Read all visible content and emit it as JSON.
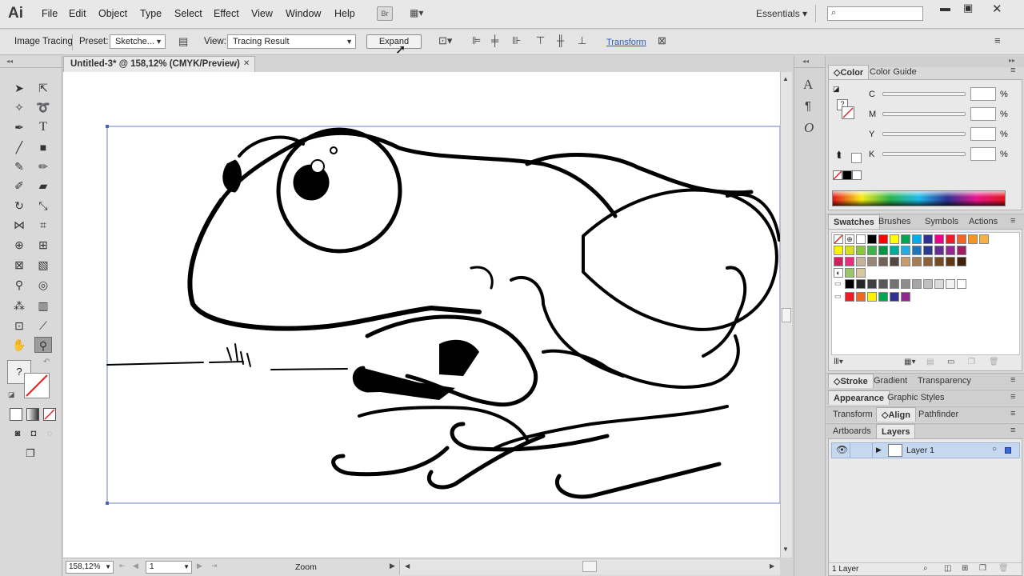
{
  "app": {
    "logo": "Ai"
  },
  "menu": [
    "File",
    "Edit",
    "Object",
    "Type",
    "Select",
    "Effect",
    "View",
    "Window",
    "Help"
  ],
  "menu_buttons": {
    "bridge": "Br"
  },
  "workspace": "Essentials",
  "control_bar": {
    "mode_label": "Image Tracing",
    "preset_label": "Preset:",
    "preset_value": "Sketche...",
    "view_label": "View:",
    "view_value": "Tracing Result",
    "expand_label": "Expand",
    "transform_link": "Transform"
  },
  "document": {
    "tab_title": "Untitled-3* @ 158,12% (CMYK/Preview)"
  },
  "status": {
    "zoom": "158,12%",
    "page": "1",
    "tool_name": "Zoom"
  },
  "color_panel": {
    "tabs": [
      "Color",
      "Color Guide"
    ],
    "channels": [
      "C",
      "M",
      "Y",
      "K"
    ],
    "unit": "%"
  },
  "swatches_panel": {
    "tabs": [
      "Swatches",
      "Brushes",
      "Symbols",
      "Actions"
    ]
  },
  "swatch_rows": [
    [
      "#ffffff",
      "#000000",
      "#ff0000",
      "#ffff00",
      "#00a651",
      "#00aeef",
      "#2e3192",
      "#ec008c",
      "#ed1c24",
      "#f26522",
      "#f7941d",
      "#fbb040"
    ],
    [
      "#fff200",
      "#d7df23",
      "#8dc63f",
      "#39b54a",
      "#009444",
      "#00a99d",
      "#27aae1",
      "#1c75bc",
      "#2b3990",
      "#662d91",
      "#92278f",
      "#9e1f63"
    ],
    [
      "#da1c5c",
      "#ee2a7b",
      "#c7b299",
      "#998675",
      "#736357",
      "#534741",
      "#c69c6d",
      "#a67c52",
      "#8c6239",
      "#754c24",
      "#603813",
      "#42210b"
    ],
    [
      "#000000",
      "#262626",
      "#404040",
      "#595959",
      "#737373",
      "#8c8c8c",
      "#a6a6a6",
      "#bfbfbf",
      "#d9d9d9",
      "#f2f2f2",
      "#ffffff"
    ],
    [
      "#ed1c24",
      "#f26522",
      "#fff200",
      "#00a651",
      "#2e3192",
      "#92278f"
    ]
  ],
  "stroke_panel": {
    "tabs": [
      "Stroke",
      "Gradient",
      "Transparency"
    ]
  },
  "appearance_panel": {
    "tabs": [
      "Appearance",
      "Graphic Styles"
    ]
  },
  "align_panel": {
    "tabs": [
      "Transform",
      "Align",
      "Pathfinder"
    ]
  },
  "layers_panel": {
    "tabs": [
      "Artboards",
      "Layers"
    ],
    "layer_name": "Layer 1",
    "footer": "1 Layer"
  },
  "colors": {
    "layer_highlight": "#c6d8f0",
    "accent_link": "#2a5ab5"
  }
}
